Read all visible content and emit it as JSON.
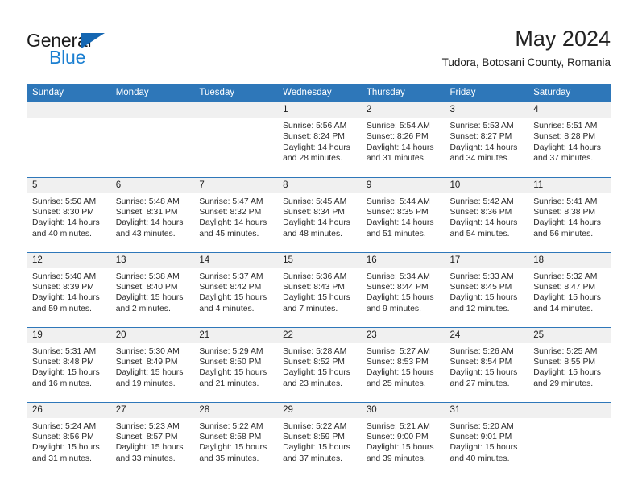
{
  "logo": {
    "word_top": "General",
    "word_bottom": "Blue",
    "triangle_color": "#1567b2",
    "blue_color": "#1b7fd1"
  },
  "header": {
    "title": "May 2024",
    "subtitle": "Tudora, Botosani County, Romania"
  },
  "theme": {
    "header_blue": "#2e77b9",
    "daynum_band": "#f0f0f0",
    "text": "#2b2b2b"
  },
  "weekdays": [
    "Sunday",
    "Monday",
    "Tuesday",
    "Wednesday",
    "Thursday",
    "Friday",
    "Saturday"
  ],
  "labels": {
    "sunrise_prefix": "Sunrise:",
    "sunset_prefix": "Sunset:",
    "daylight_prefix": "Daylight:"
  },
  "weeks": [
    [
      {
        "day": "",
        "lines": []
      },
      {
        "day": "",
        "lines": []
      },
      {
        "day": "",
        "lines": []
      },
      {
        "day": "1",
        "lines": [
          "Sunrise: 5:56 AM",
          "Sunset: 8:24 PM",
          "Daylight: 14 hours",
          "and 28 minutes."
        ]
      },
      {
        "day": "2",
        "lines": [
          "Sunrise: 5:54 AM",
          "Sunset: 8:26 PM",
          "Daylight: 14 hours",
          "and 31 minutes."
        ]
      },
      {
        "day": "3",
        "lines": [
          "Sunrise: 5:53 AM",
          "Sunset: 8:27 PM",
          "Daylight: 14 hours",
          "and 34 minutes."
        ]
      },
      {
        "day": "4",
        "lines": [
          "Sunrise: 5:51 AM",
          "Sunset: 8:28 PM",
          "Daylight: 14 hours",
          "and 37 minutes."
        ]
      }
    ],
    [
      {
        "day": "5",
        "lines": [
          "Sunrise: 5:50 AM",
          "Sunset: 8:30 PM",
          "Daylight: 14 hours",
          "and 40 minutes."
        ]
      },
      {
        "day": "6",
        "lines": [
          "Sunrise: 5:48 AM",
          "Sunset: 8:31 PM",
          "Daylight: 14 hours",
          "and 43 minutes."
        ]
      },
      {
        "day": "7",
        "lines": [
          "Sunrise: 5:47 AM",
          "Sunset: 8:32 PM",
          "Daylight: 14 hours",
          "and 45 minutes."
        ]
      },
      {
        "day": "8",
        "lines": [
          "Sunrise: 5:45 AM",
          "Sunset: 8:34 PM",
          "Daylight: 14 hours",
          "and 48 minutes."
        ]
      },
      {
        "day": "9",
        "lines": [
          "Sunrise: 5:44 AM",
          "Sunset: 8:35 PM",
          "Daylight: 14 hours",
          "and 51 minutes."
        ]
      },
      {
        "day": "10",
        "lines": [
          "Sunrise: 5:42 AM",
          "Sunset: 8:36 PM",
          "Daylight: 14 hours",
          "and 54 minutes."
        ]
      },
      {
        "day": "11",
        "lines": [
          "Sunrise: 5:41 AM",
          "Sunset: 8:38 PM",
          "Daylight: 14 hours",
          "and 56 minutes."
        ]
      }
    ],
    [
      {
        "day": "12",
        "lines": [
          "Sunrise: 5:40 AM",
          "Sunset: 8:39 PM",
          "Daylight: 14 hours",
          "and 59 minutes."
        ]
      },
      {
        "day": "13",
        "lines": [
          "Sunrise: 5:38 AM",
          "Sunset: 8:40 PM",
          "Daylight: 15 hours",
          "and 2 minutes."
        ]
      },
      {
        "day": "14",
        "lines": [
          "Sunrise: 5:37 AM",
          "Sunset: 8:42 PM",
          "Daylight: 15 hours",
          "and 4 minutes."
        ]
      },
      {
        "day": "15",
        "lines": [
          "Sunrise: 5:36 AM",
          "Sunset: 8:43 PM",
          "Daylight: 15 hours",
          "and 7 minutes."
        ]
      },
      {
        "day": "16",
        "lines": [
          "Sunrise: 5:34 AM",
          "Sunset: 8:44 PM",
          "Daylight: 15 hours",
          "and 9 minutes."
        ]
      },
      {
        "day": "17",
        "lines": [
          "Sunrise: 5:33 AM",
          "Sunset: 8:45 PM",
          "Daylight: 15 hours",
          "and 12 minutes."
        ]
      },
      {
        "day": "18",
        "lines": [
          "Sunrise: 5:32 AM",
          "Sunset: 8:47 PM",
          "Daylight: 15 hours",
          "and 14 minutes."
        ]
      }
    ],
    [
      {
        "day": "19",
        "lines": [
          "Sunrise: 5:31 AM",
          "Sunset: 8:48 PM",
          "Daylight: 15 hours",
          "and 16 minutes."
        ]
      },
      {
        "day": "20",
        "lines": [
          "Sunrise: 5:30 AM",
          "Sunset: 8:49 PM",
          "Daylight: 15 hours",
          "and 19 minutes."
        ]
      },
      {
        "day": "21",
        "lines": [
          "Sunrise: 5:29 AM",
          "Sunset: 8:50 PM",
          "Daylight: 15 hours",
          "and 21 minutes."
        ]
      },
      {
        "day": "22",
        "lines": [
          "Sunrise: 5:28 AM",
          "Sunset: 8:52 PM",
          "Daylight: 15 hours",
          "and 23 minutes."
        ]
      },
      {
        "day": "23",
        "lines": [
          "Sunrise: 5:27 AM",
          "Sunset: 8:53 PM",
          "Daylight: 15 hours",
          "and 25 minutes."
        ]
      },
      {
        "day": "24",
        "lines": [
          "Sunrise: 5:26 AM",
          "Sunset: 8:54 PM",
          "Daylight: 15 hours",
          "and 27 minutes."
        ]
      },
      {
        "day": "25",
        "lines": [
          "Sunrise: 5:25 AM",
          "Sunset: 8:55 PM",
          "Daylight: 15 hours",
          "and 29 minutes."
        ]
      }
    ],
    [
      {
        "day": "26",
        "lines": [
          "Sunrise: 5:24 AM",
          "Sunset: 8:56 PM",
          "Daylight: 15 hours",
          "and 31 minutes."
        ]
      },
      {
        "day": "27",
        "lines": [
          "Sunrise: 5:23 AM",
          "Sunset: 8:57 PM",
          "Daylight: 15 hours",
          "and 33 minutes."
        ]
      },
      {
        "day": "28",
        "lines": [
          "Sunrise: 5:22 AM",
          "Sunset: 8:58 PM",
          "Daylight: 15 hours",
          "and 35 minutes."
        ]
      },
      {
        "day": "29",
        "lines": [
          "Sunrise: 5:22 AM",
          "Sunset: 8:59 PM",
          "Daylight: 15 hours",
          "and 37 minutes."
        ]
      },
      {
        "day": "30",
        "lines": [
          "Sunrise: 5:21 AM",
          "Sunset: 9:00 PM",
          "Daylight: 15 hours",
          "and 39 minutes."
        ]
      },
      {
        "day": "31",
        "lines": [
          "Sunrise: 5:20 AM",
          "Sunset: 9:01 PM",
          "Daylight: 15 hours",
          "and 40 minutes."
        ]
      },
      {
        "day": "",
        "lines": []
      }
    ]
  ]
}
